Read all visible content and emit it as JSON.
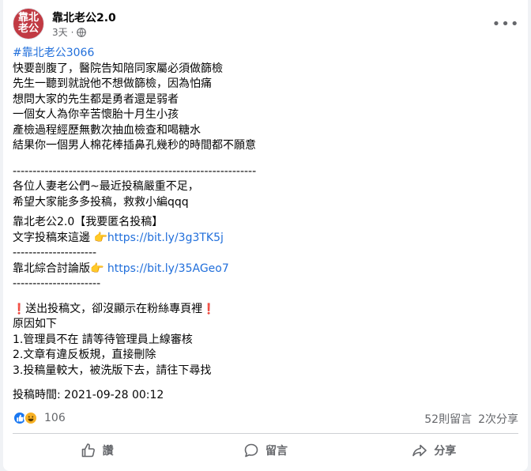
{
  "header": {
    "avatar_text_top": "靠北",
    "avatar_text_bottom": "老公",
    "page_name": "靠北老公2.0",
    "time": "3天",
    "dot": "·",
    "more": "•••"
  },
  "post": {
    "hashtag": "#靠北老公3066",
    "lines": [
      "快要剖腹了，醫院告知陪同家屬必須做篩檢",
      "先生一聽到就說他不想做篩檢，因為怕痛",
      "想問大家的先生都是勇者還是弱者",
      "一個女人為你辛苦懷胎十月生小孩",
      "產檢過程經歷無數次抽血檢查和喝糖水",
      "結果你一個男人棉花棒插鼻孔幾秒的時間都不願意"
    ],
    "separator_long": "-------------------------------------------------------------",
    "notice_line1": "各位人妻老公們~最近投稿嚴重不足，",
    "notice_line2": "希望大家能多多投稿，救救小編qqq",
    "anon_title": "靠北老公2.0【我要匿名投稿】",
    "text_submit_label": "文字投稿來這邊 👉",
    "text_submit_link": "https://bit.ly/3g3TK5j",
    "separator_short1": "---------------------",
    "forum_label": "靠北綜合討論版👉 ",
    "forum_link": "https://bit.ly/35AGeo7",
    "separator_short2": "----------------------",
    "warn_mark": "❗",
    "warn_text": "送出投稿文，卻沒顯示在粉絲專頁裡",
    "reason_title": "原因如下",
    "reasons": [
      "1.管理員不在 請等待管理員上線審核",
      "2.文章有違反板規，直接刪除",
      "3.投稿量較大，被洗版下去，請往下尋找"
    ],
    "submitted_time": "投稿時間: 2021-09-28 00:12"
  },
  "stats": {
    "reaction_count": "106",
    "comments": "52則留言",
    "shares": "2次分享"
  },
  "actions": {
    "like": "讚",
    "comment": "留言",
    "share": "分享"
  }
}
